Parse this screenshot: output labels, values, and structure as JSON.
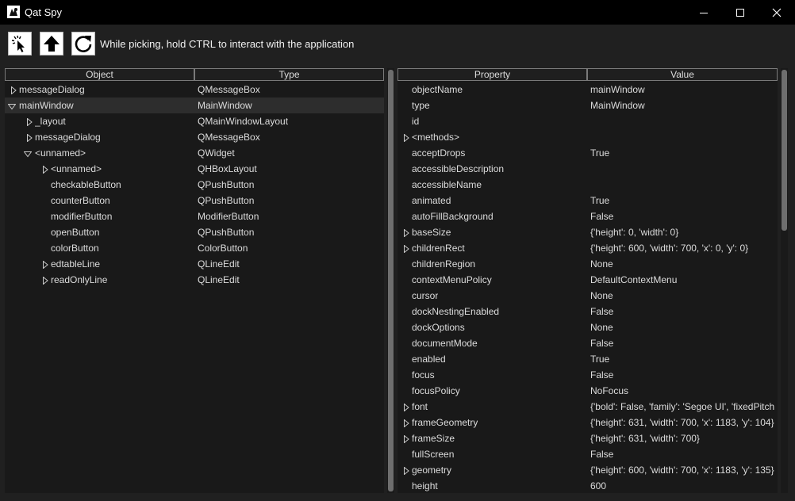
{
  "window": {
    "title": "Qat Spy"
  },
  "toolbar": {
    "pick_icon": "pick-cursor-icon",
    "up_icon": "arrow-up-icon",
    "refresh_icon": "refresh-icon",
    "hint": "While picking, hold CTRL to interact with the application"
  },
  "object_tree": {
    "columns": [
      "Object",
      "Type"
    ],
    "rows": [
      {
        "name": "messageDialog",
        "type": "QMessageBox",
        "depth": 0,
        "expander": "collapsed"
      },
      {
        "name": "mainWindow",
        "type": "MainWindow",
        "depth": 0,
        "expander": "expanded",
        "selected": true
      },
      {
        "name": "_layout",
        "type": "QMainWindowLayout",
        "depth": 1,
        "expander": "collapsed"
      },
      {
        "name": "messageDialog",
        "type": "QMessageBox",
        "depth": 1,
        "expander": "collapsed"
      },
      {
        "name": "<unnamed>",
        "type": "QWidget",
        "depth": 1,
        "expander": "expanded"
      },
      {
        "name": "<unnamed>",
        "type": "QHBoxLayout",
        "depth": 2,
        "expander": "collapsed"
      },
      {
        "name": "checkableButton",
        "type": "QPushButton",
        "depth": 2,
        "expander": "none"
      },
      {
        "name": "counterButton",
        "type": "QPushButton",
        "depth": 2,
        "expander": "none"
      },
      {
        "name": "modifierButton",
        "type": "ModifierButton",
        "depth": 2,
        "expander": "none"
      },
      {
        "name": "openButton",
        "type": "QPushButton",
        "depth": 2,
        "expander": "none"
      },
      {
        "name": "colorButton",
        "type": "ColorButton",
        "depth": 2,
        "expander": "none"
      },
      {
        "name": "edtableLine",
        "type": "QLineEdit",
        "depth": 2,
        "expander": "collapsed"
      },
      {
        "name": "readOnlyLine",
        "type": "QLineEdit",
        "depth": 2,
        "expander": "collapsed"
      }
    ]
  },
  "properties": {
    "columns": [
      "Property",
      "Value"
    ],
    "rows": [
      {
        "name": "objectName",
        "value": "mainWindow",
        "expander": "none"
      },
      {
        "name": "type",
        "value": "MainWindow",
        "expander": "none"
      },
      {
        "name": "id",
        "value": "",
        "expander": "none"
      },
      {
        "name": "<methods>",
        "value": "",
        "expander": "collapsed"
      },
      {
        "name": "acceptDrops",
        "value": "True",
        "expander": "none"
      },
      {
        "name": "accessibleDescription",
        "value": "",
        "expander": "none"
      },
      {
        "name": "accessibleName",
        "value": "",
        "expander": "none"
      },
      {
        "name": "animated",
        "value": "True",
        "expander": "none"
      },
      {
        "name": "autoFillBackground",
        "value": "False",
        "expander": "none"
      },
      {
        "name": "baseSize",
        "value": "{'height': 0, 'width': 0}",
        "expander": "collapsed"
      },
      {
        "name": "childrenRect",
        "value": "{'height': 600, 'width': 700, 'x': 0, 'y': 0}",
        "expander": "collapsed"
      },
      {
        "name": "childrenRegion",
        "value": "None",
        "expander": "none"
      },
      {
        "name": "contextMenuPolicy",
        "value": "DefaultContextMenu",
        "expander": "none"
      },
      {
        "name": "cursor",
        "value": "None",
        "expander": "none"
      },
      {
        "name": "dockNestingEnabled",
        "value": "False",
        "expander": "none"
      },
      {
        "name": "dockOptions",
        "value": "None",
        "expander": "none"
      },
      {
        "name": "documentMode",
        "value": "False",
        "expander": "none"
      },
      {
        "name": "enabled",
        "value": "True",
        "expander": "none"
      },
      {
        "name": "focus",
        "value": "False",
        "expander": "none"
      },
      {
        "name": "focusPolicy",
        "value": "NoFocus",
        "expander": "none"
      },
      {
        "name": "font",
        "value": "{'bold': False, 'family': 'Segoe UI', 'fixedPitch",
        "expander": "collapsed"
      },
      {
        "name": "frameGeometry",
        "value": "{'height': 631, 'width': 700, 'x': 1183, 'y': 104}",
        "expander": "collapsed"
      },
      {
        "name": "frameSize",
        "value": "{'height': 631, 'width': 700}",
        "expander": "collapsed"
      },
      {
        "name": "fullScreen",
        "value": "False",
        "expander": "none"
      },
      {
        "name": "geometry",
        "value": "{'height': 600, 'width': 700, 'x': 1183, 'y': 135}",
        "expander": "collapsed"
      },
      {
        "name": "height",
        "value": "600",
        "expander": "none"
      }
    ]
  }
}
